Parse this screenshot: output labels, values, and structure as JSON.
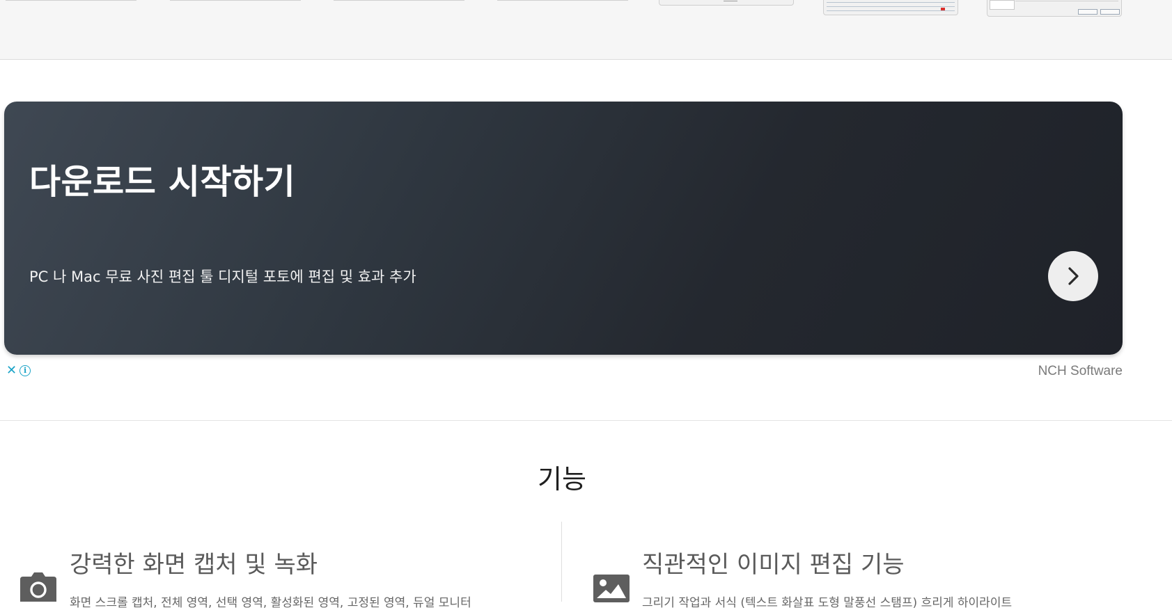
{
  "ad": {
    "title": "다운로드 시작하기",
    "description": "PC 나 Mac 무료 사진 편집 툴 디지털 포토에 편집 및 효과 추가",
    "advertiser": "NCH Software",
    "close_icon": "close-icon",
    "info_icon": "info-icon",
    "next_icon": "chevron-right-icon",
    "close_glyph": "✕",
    "info_glyph": "i"
  },
  "features": {
    "heading": "기능",
    "items": [
      {
        "icon": "camera-icon",
        "title": "강력한 화면 캡처 및 녹화",
        "text": "화면 스크롤 캡처, 전체 영역, 선택 영역, 활성화된 영역, 고정된 영역, 듀얼 모니터"
      },
      {
        "icon": "image-icon",
        "title": "직관적인 이미지 편집 기능",
        "text": "그리기 작업과 서식 (텍스트 화살표 도형 말풍선 스탬프) 흐리게 하이라이트"
      }
    ]
  },
  "colors": {
    "accent": "#1aa3c7",
    "banner_dark": "#24282f",
    "banner_light": "#3f4853"
  }
}
